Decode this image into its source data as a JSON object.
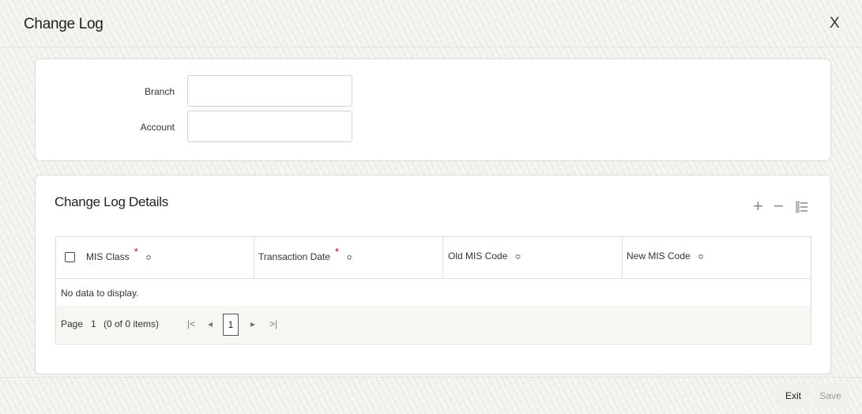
{
  "window": {
    "title": "Change Log",
    "close_label": "X"
  },
  "form": {
    "branch_label": "Branch",
    "branch_value": "",
    "account_label": "Account",
    "account_value": ""
  },
  "details": {
    "title": "Change Log Details",
    "add_icon": "plus-icon",
    "remove_icon": "minus-icon",
    "view_icon": "list-view-icon",
    "columns": [
      {
        "label": "MIS Class",
        "required": "*"
      },
      {
        "label": "Transaction Date",
        "required": "*"
      },
      {
        "label": "Old MIS Code"
      },
      {
        "label": "New MIS Code"
      }
    ],
    "sort_glyph": "≎",
    "empty_text": "No data to display."
  },
  "pagination": {
    "page_label": "Page",
    "page_number": "1",
    "items_text": "(0 of 0 items)",
    "first": "|<",
    "prev": "◂",
    "current": "1",
    "next": "▸",
    "last": ">|"
  },
  "footer": {
    "exit_label": "Exit",
    "save_label": "Save"
  },
  "colors": {
    "required": "#d0021b",
    "panel": "#ffffff",
    "background": "#f6f5f2"
  }
}
